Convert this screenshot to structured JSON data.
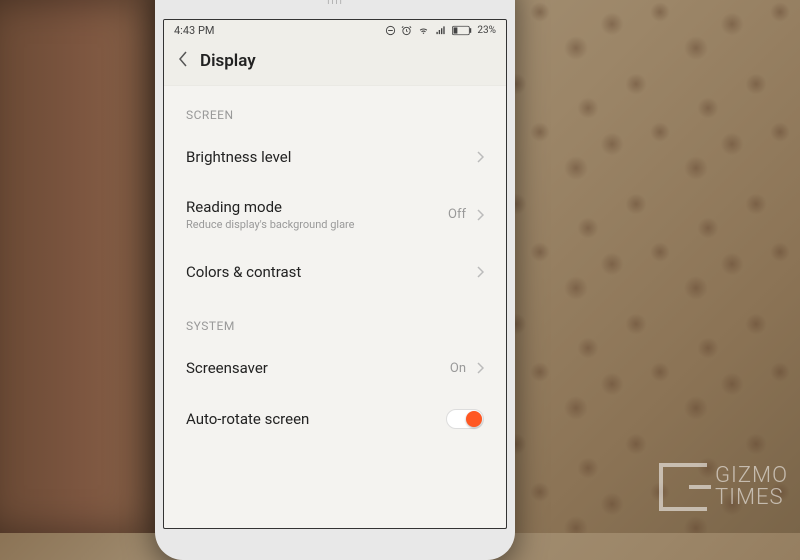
{
  "status": {
    "time": "4:43 PM",
    "battery": "23%"
  },
  "header": {
    "title": "Display"
  },
  "sections": {
    "screen_label": "SCREEN",
    "system_label": "SYSTEM"
  },
  "settings": {
    "brightness": {
      "title": "Brightness level"
    },
    "reading": {
      "title": "Reading mode",
      "sub": "Reduce display's background glare",
      "value": "Off"
    },
    "colors": {
      "title": "Colors & contrast"
    },
    "screensaver": {
      "title": "Screensaver",
      "value": "On"
    },
    "autorotate": {
      "title": "Auto-rotate screen",
      "toggle": true
    }
  },
  "watermark": {
    "line1": "GIZMO",
    "line2": "TIMES"
  }
}
